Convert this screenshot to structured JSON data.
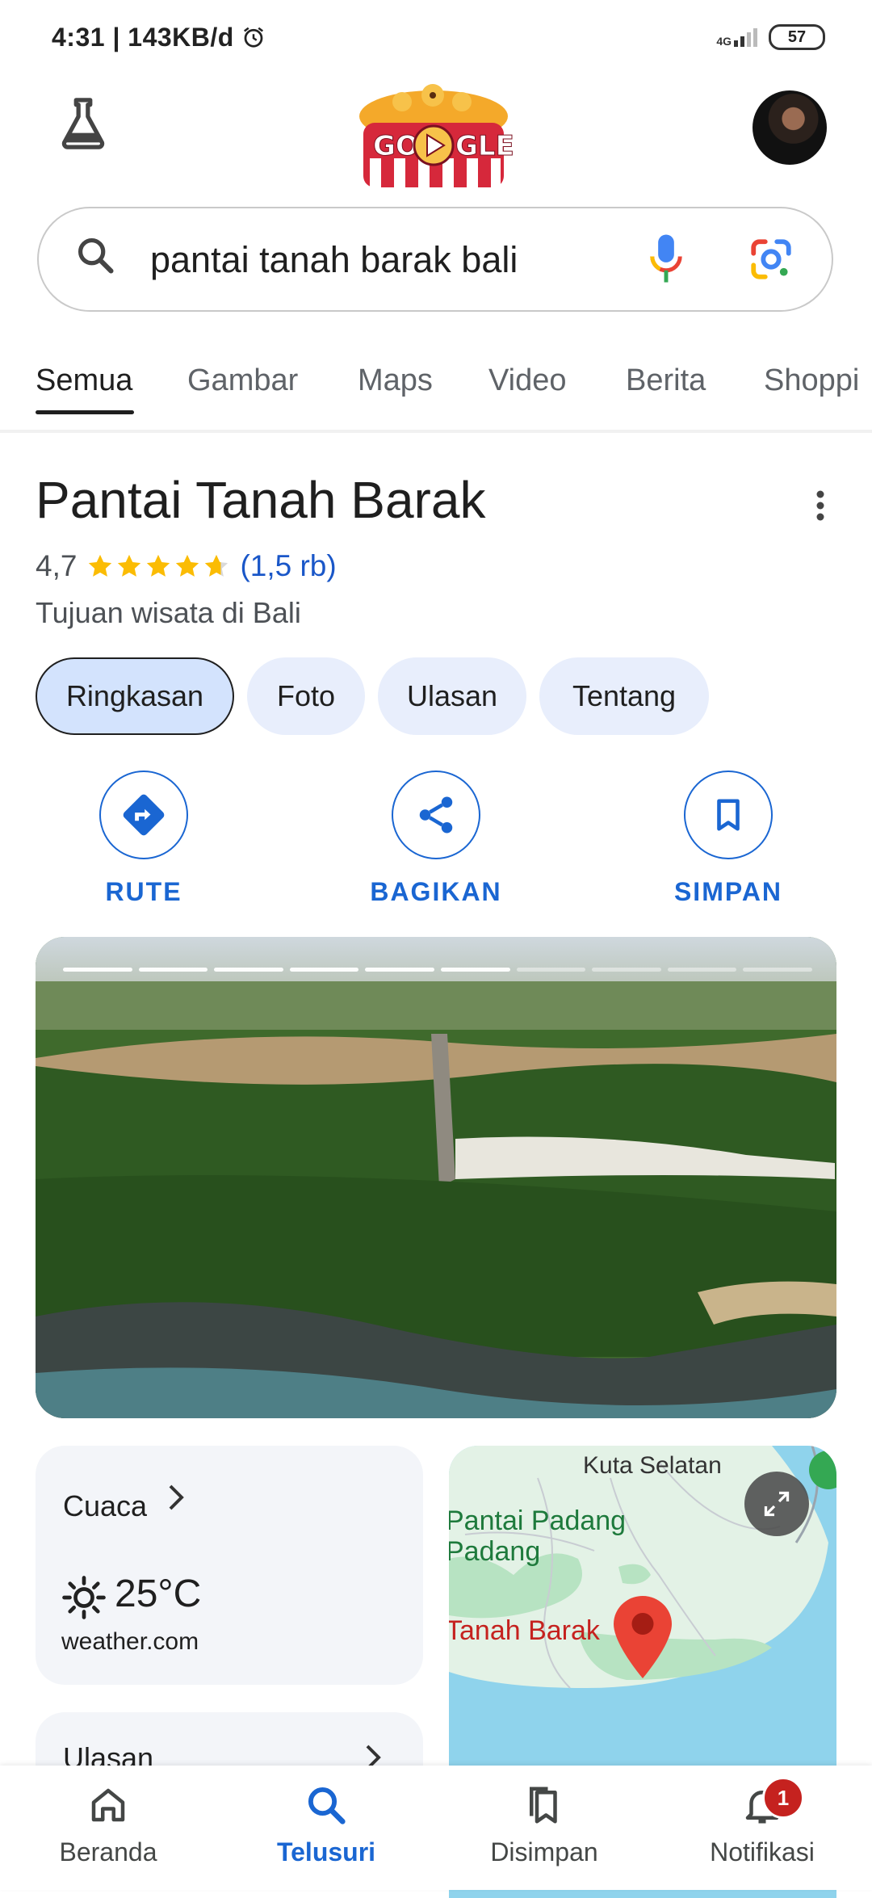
{
  "status_bar": {
    "time": "4:31",
    "data_rate": "143KB/d",
    "network": "4G",
    "battery": "57"
  },
  "search": {
    "query": "pantai tanah barak bali"
  },
  "tabs": [
    {
      "label": "Semua",
      "active": true
    },
    {
      "label": "Gambar"
    },
    {
      "label": "Maps"
    },
    {
      "label": "Video"
    },
    {
      "label": "Berita"
    },
    {
      "label": "Shoppi"
    }
  ],
  "place": {
    "title": "Pantai Tanah Barak",
    "rating": "4,7",
    "rating_stars": 4.7,
    "review_count": "(1,5 rb)",
    "category": "Tujuan wisata di Bali"
  },
  "chips": [
    {
      "label": "Ringkasan",
      "active": true
    },
    {
      "label": "Foto"
    },
    {
      "label": "Ulasan"
    },
    {
      "label": "Tentang"
    }
  ],
  "actions": [
    {
      "label": "RUTE",
      "icon": "directions-icon"
    },
    {
      "label": "BAGIKAN",
      "icon": "share-icon"
    },
    {
      "label": "SIMPAN",
      "icon": "bookmark-icon"
    }
  ],
  "photo": {
    "slides_total": 10,
    "slides_viewed": 6
  },
  "weather": {
    "title": "Cuaca",
    "temperature": "25°C",
    "source": "weather.com"
  },
  "reviews_card": {
    "title": "Ulasan"
  },
  "map": {
    "labels": [
      "Kuta Selatan",
      "Pantai Padang",
      "Padang",
      "Tanah Barak"
    ]
  },
  "bottom_nav": [
    {
      "label": "Beranda",
      "icon": "home-icon"
    },
    {
      "label": "Telusuri",
      "icon": "search-icon",
      "active": true
    },
    {
      "label": "Disimpan",
      "icon": "bookmarks-icon"
    },
    {
      "label": "Notifikasi",
      "icon": "bell-icon",
      "badge": "1"
    }
  ],
  "colors": {
    "accent": "#1a66d2",
    "star": "#fbbc04",
    "chip_bg": "#e8eefc",
    "badge": "#c5221f"
  }
}
